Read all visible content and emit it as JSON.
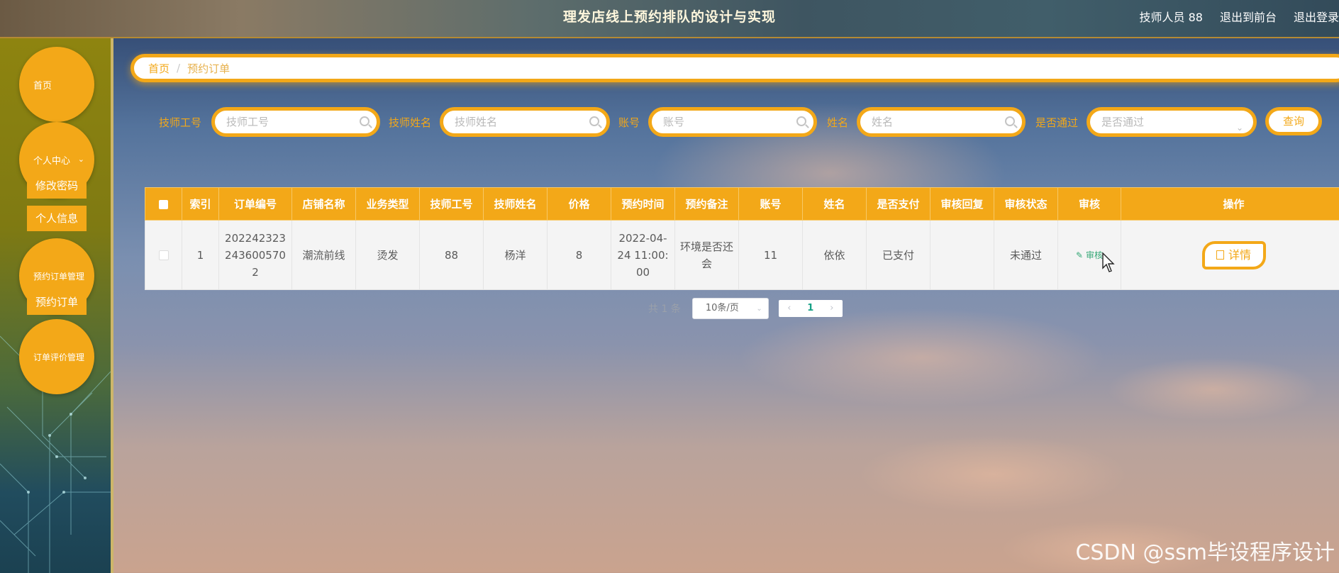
{
  "app": {
    "title": "理发店线上预约排队的设计与实现",
    "user_label": "技师人员 88",
    "back_to_front": "退出到前台",
    "logout": "退出登录"
  },
  "sidebar": {
    "home": "首页",
    "personal_center": "个人中心",
    "change_password": "修改密码",
    "personal_info": "个人信息",
    "order_mgmt": "预约订单管理",
    "orders": "预约订单",
    "review_mgmt": "订单评价管理"
  },
  "breadcrumb": {
    "home": "首页",
    "separator": "/",
    "current": "预约订单"
  },
  "search": {
    "tech_id_label": "技师工号",
    "tech_id_placeholder": "技师工号",
    "tech_name_label": "技师姓名",
    "tech_name_placeholder": "技师姓名",
    "account_label": "账号",
    "account_placeholder": "账号",
    "name_label": "姓名",
    "name_placeholder": "姓名",
    "passed_label": "是否通过",
    "passed_placeholder": "是否通过",
    "query_button": "查询"
  },
  "table": {
    "headers": [
      "索引",
      "订单编号",
      "店铺名称",
      "业务类型",
      "技师工号",
      "技师姓名",
      "价格",
      "预约时间",
      "预约备注",
      "账号",
      "姓名",
      "是否支付",
      "审核回复",
      "审核状态",
      "审核",
      "操作"
    ],
    "rows": [
      {
        "index": "1",
        "order_no": "2022423232436005702",
        "shop": "潮流前线",
        "service": "烫发",
        "tech_id": "88",
        "tech_name": "杨洋",
        "price": "8",
        "time": "2022-04-24 11:00:00",
        "note": "环境是否还会",
        "account": "11",
        "name": "依依",
        "paid": "已支付",
        "reply": "",
        "status": "未通过",
        "review_link": "审核",
        "detail_button": "详情"
      }
    ]
  },
  "pagination": {
    "total": "共 1 条",
    "page_size": "10条/页",
    "prev": "‹",
    "current": "1",
    "next": "›"
  },
  "watermark": "CSDN @ssm毕设程序设计",
  "colors": {
    "accent": "#f3a818",
    "link": "#35a776"
  },
  "icons": [
    "search-icon",
    "chevron-down-icon",
    "edit-icon",
    "doc-icon",
    "cursor-icon"
  ]
}
